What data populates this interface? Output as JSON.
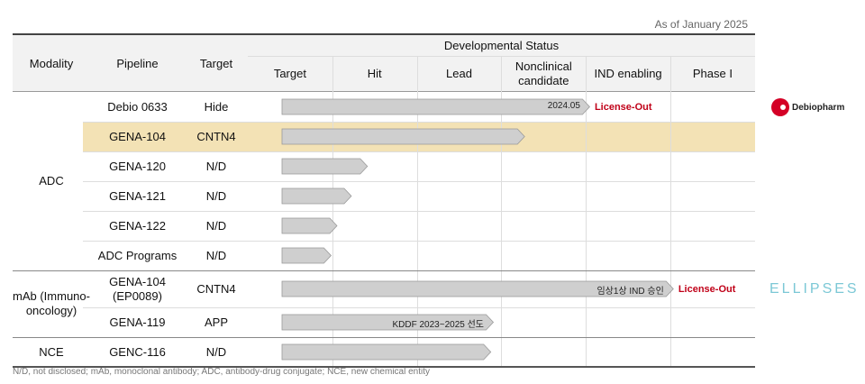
{
  "as_of": "As of January 2025",
  "header": {
    "modality": "Modality",
    "pipeline": "Pipeline",
    "target": "Target",
    "status": "Developmental Status",
    "stages": [
      "Target",
      "Hit",
      "Lead",
      "Nonclinical candidate",
      "IND enabling",
      "Phase I"
    ]
  },
  "groups": [
    {
      "modality": "ADC",
      "rows": [
        0,
        1,
        2,
        3,
        4,
        5
      ]
    },
    {
      "modality": "mAb (Immuno-oncology)",
      "rows": [
        6,
        7
      ]
    },
    {
      "modality": "NCE",
      "rows": [
        8
      ]
    }
  ],
  "rows": [
    {
      "pipeline": "Debio 0633",
      "target": "Hide",
      "progress_stage": 4.04,
      "bar_label": "2024.05",
      "status": "License-Out",
      "partner": "Debiopharm",
      "highlight": false
    },
    {
      "pipeline": "GENA-104",
      "target": "CNTN4",
      "progress_stage": 3.27,
      "highlight": true
    },
    {
      "pipeline": "GENA-120",
      "target": "N/D",
      "progress_stage": 1.41
    },
    {
      "pipeline": "GENA-121",
      "target": "N/D",
      "progress_stage": 1.22
    },
    {
      "pipeline": "GENA-122",
      "target": "N/D",
      "progress_stage": 1.05
    },
    {
      "pipeline": "ADC Programs",
      "target": "N/D",
      "progress_stage": 0.98
    },
    {
      "pipeline": "GENA-104 (EP0089)",
      "target": "CNTN4",
      "progress_stage": 5.03,
      "bar_label": "임상1상 IND 승인",
      "status": "License-Out",
      "partner": "ELLIPSES"
    },
    {
      "pipeline": "GENA-119",
      "target": "APP",
      "progress_stage": 2.9,
      "bar_label": "KDDF 2023~2025  선도"
    },
    {
      "pipeline": "GENC-116",
      "target": "N/D",
      "progress_stage": 2.87
    }
  ],
  "colors": {
    "bar": "#cfcfcf",
    "highlight": "#f3e2b5",
    "license": "#c00018",
    "debiopharm": "#d40026",
    "ellipses": "#7cc8d6"
  },
  "footnote": "N/D, not disclosed; mAb, monoclonal antibody; ADC, antibody-drug conjugate; NCE, new chemical entity"
}
